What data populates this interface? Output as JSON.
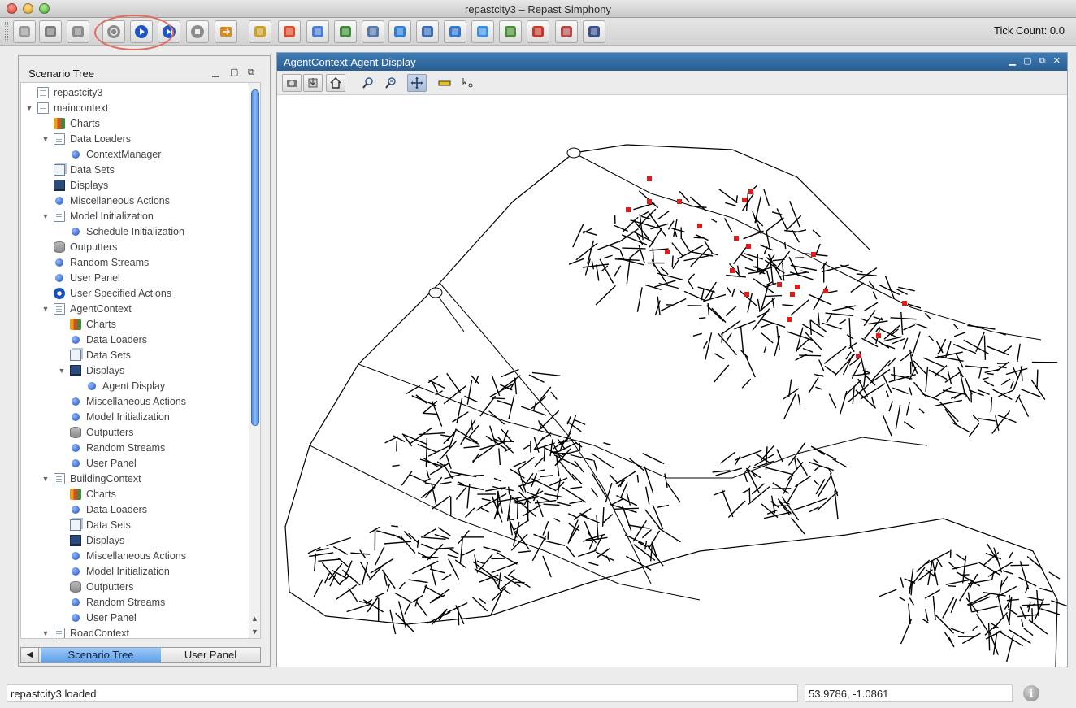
{
  "window": {
    "title": "repastcity3 – Repast Simphony"
  },
  "toolbar": {
    "tick_label": "Tick Count: 0.0",
    "buttons": [
      {
        "name": "open-model-icon"
      },
      {
        "name": "save-icon"
      },
      {
        "name": "database-icon"
      },
      {
        "name": "initialize-icon"
      },
      {
        "name": "play-icon"
      },
      {
        "name": "step-icon"
      },
      {
        "name": "stop-icon"
      },
      {
        "name": "reset-icon"
      },
      {
        "name": "charting-icon"
      },
      {
        "name": "color-grid-icon"
      },
      {
        "name": "people-icon"
      },
      {
        "name": "pie-chart-icon"
      },
      {
        "name": "calculator-icon"
      },
      {
        "name": "globe-icon"
      },
      {
        "name": "magnifier-icon"
      },
      {
        "name": "network-globe-icon"
      },
      {
        "name": "earth-icon"
      },
      {
        "name": "agents-icon"
      },
      {
        "name": "bar-chart-icon"
      },
      {
        "name": "spreadsheet-icon"
      },
      {
        "name": "tractor-icon"
      }
    ]
  },
  "scenario_tree": {
    "title": "Scenario Tree",
    "items": [
      {
        "label": "repastcity3",
        "icon": "doc",
        "level": 0,
        "toggle": ""
      },
      {
        "label": "maincontext",
        "icon": "doc",
        "level": 0,
        "toggle": "▼"
      },
      {
        "label": "Charts",
        "icon": "chart",
        "level": 1,
        "toggle": ""
      },
      {
        "label": "Data Loaders",
        "icon": "doc",
        "level": 1,
        "toggle": "▼"
      },
      {
        "label": "ContextManager",
        "icon": "dot",
        "level": 2,
        "toggle": ""
      },
      {
        "label": "Data Sets",
        "icon": "sets",
        "level": 1,
        "toggle": ""
      },
      {
        "label": "Displays",
        "icon": "display",
        "level": 1,
        "toggle": ""
      },
      {
        "label": "Miscellaneous Actions",
        "icon": "dot",
        "level": 1,
        "toggle": ""
      },
      {
        "label": "Model Initialization",
        "icon": "doc",
        "level": 1,
        "toggle": "▼"
      },
      {
        "label": "Schedule Initialization",
        "icon": "dot",
        "level": 2,
        "toggle": ""
      },
      {
        "label": "Outputters",
        "icon": "db",
        "level": 1,
        "toggle": ""
      },
      {
        "label": "Random Streams",
        "icon": "dot",
        "level": 1,
        "toggle": ""
      },
      {
        "label": "User Panel",
        "icon": "dot",
        "level": 1,
        "toggle": ""
      },
      {
        "label": "User Specified Actions",
        "icon": "user",
        "level": 1,
        "toggle": ""
      },
      {
        "label": "AgentContext",
        "icon": "doc",
        "level": 1,
        "toggle": "▼"
      },
      {
        "label": "Charts",
        "icon": "chart",
        "level": 2,
        "toggle": ""
      },
      {
        "label": "Data Loaders",
        "icon": "dot",
        "level": 2,
        "toggle": ""
      },
      {
        "label": "Data Sets",
        "icon": "sets",
        "level": 2,
        "toggle": ""
      },
      {
        "label": "Displays",
        "icon": "display",
        "level": 2,
        "toggle": "▼"
      },
      {
        "label": "Agent Display",
        "icon": "dot",
        "level": 3,
        "toggle": ""
      },
      {
        "label": "Miscellaneous Actions",
        "icon": "dot",
        "level": 2,
        "toggle": ""
      },
      {
        "label": "Model Initialization",
        "icon": "dot",
        "level": 2,
        "toggle": ""
      },
      {
        "label": "Outputters",
        "icon": "db",
        "level": 2,
        "toggle": ""
      },
      {
        "label": "Random Streams",
        "icon": "dot",
        "level": 2,
        "toggle": ""
      },
      {
        "label": "User Panel",
        "icon": "dot",
        "level": 2,
        "toggle": ""
      },
      {
        "label": "BuildingContext",
        "icon": "doc",
        "level": 1,
        "toggle": "▼"
      },
      {
        "label": "Charts",
        "icon": "chart",
        "level": 2,
        "toggle": ""
      },
      {
        "label": "Data Loaders",
        "icon": "dot",
        "level": 2,
        "toggle": ""
      },
      {
        "label": "Data Sets",
        "icon": "sets",
        "level": 2,
        "toggle": ""
      },
      {
        "label": "Displays",
        "icon": "display",
        "level": 2,
        "toggle": ""
      },
      {
        "label": "Miscellaneous Actions",
        "icon": "dot",
        "level": 2,
        "toggle": ""
      },
      {
        "label": "Model Initialization",
        "icon": "dot",
        "level": 2,
        "toggle": ""
      },
      {
        "label": "Outputters",
        "icon": "db",
        "level": 2,
        "toggle": ""
      },
      {
        "label": "Random Streams",
        "icon": "dot",
        "level": 2,
        "toggle": ""
      },
      {
        "label": "User Panel",
        "icon": "dot",
        "level": 2,
        "toggle": ""
      },
      {
        "label": "RoadContext",
        "icon": "doc",
        "level": 1,
        "toggle": "▼"
      }
    ]
  },
  "bottom_tabs": {
    "active": "Scenario Tree",
    "inactive": "User Panel"
  },
  "display": {
    "title": "AgentContext:Agent Display",
    "tools": [
      "camera-icon",
      "export-icon",
      "home-icon",
      "zoom-in-icon",
      "zoom-out-icon",
      "pan-icon",
      "ruler-icon",
      "select-cursor-icon"
    ],
    "agent_color": "#e01b1b",
    "road_color": "#000000"
  },
  "status": {
    "message": "repastcity3 loaded",
    "coordinates": "53.9786, -1.0861"
  }
}
